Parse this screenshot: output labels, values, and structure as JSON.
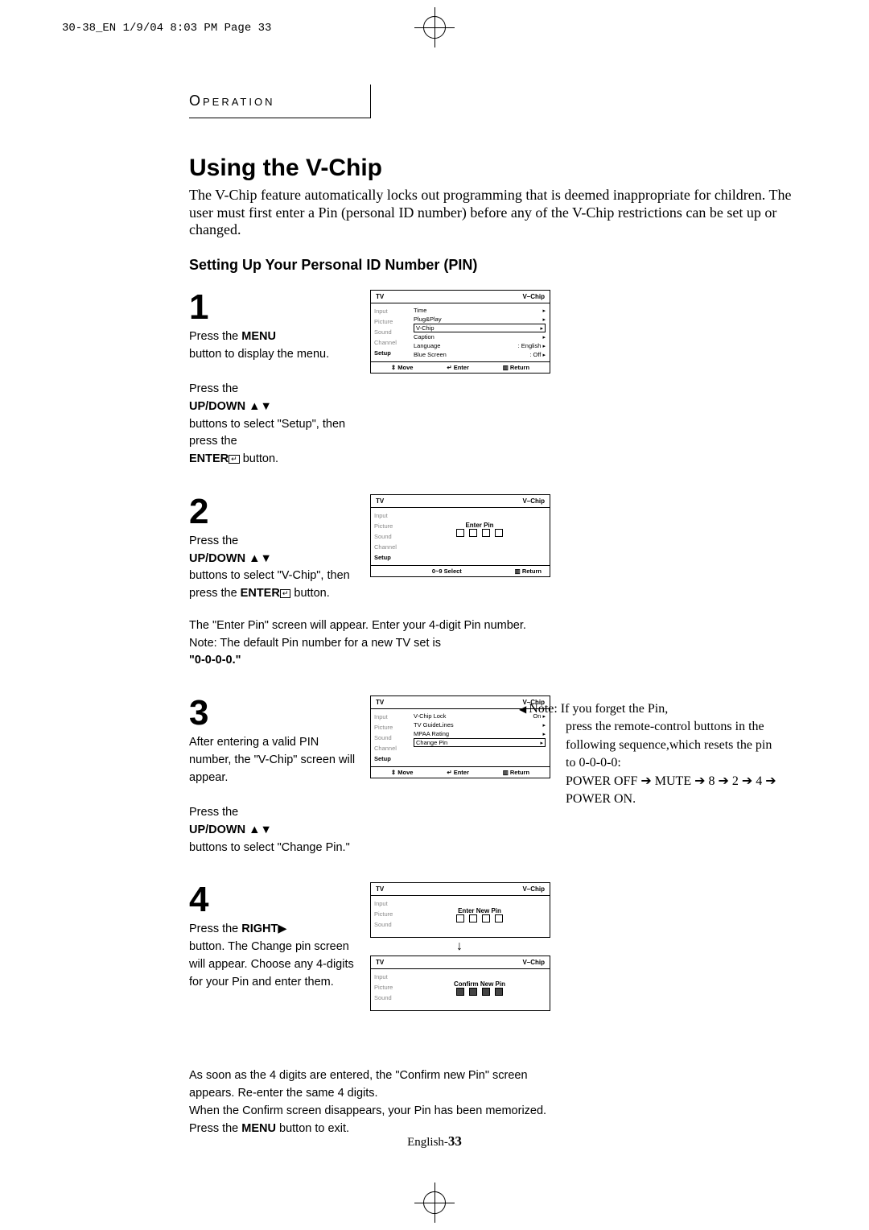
{
  "page_meta": "30-38_EN  1/9/04 8:03 PM  Page 33",
  "section_tab": "Operation",
  "title": "Using the V-Chip",
  "intro": "The V-Chip feature automatically locks out programming that is deemed inappropriate for children. The user must first enter a Pin (personal ID number) before any of the V-Chip restrictions can be set up or changed.",
  "subheading": "Setting Up Your Personal ID Number (PIN)",
  "steps": {
    "s1": {
      "num": "1",
      "t1": "Press the ",
      "t1b": "MENU",
      "t2": "button to display the menu.",
      "t3": "Press the",
      "t3b": "UP/DOWN",
      "t4": "buttons to select \"Setup\", then press the",
      "t4b": "ENTER",
      "t5": " button."
    },
    "s2": {
      "num": "2",
      "t1": "Press the",
      "t1b": "UP/DOWN",
      "t2": "buttons to select \"V-Chip\", then press the ",
      "t2b": "ENTER",
      "t3": " button.",
      "post": "The \"Enter Pin\" screen will appear. Enter your 4-digit Pin number. Note: The default Pin number for a new TV set is",
      "postb": "\"0-0-0-0.\""
    },
    "s3": {
      "num": "3",
      "t1": "After entering a valid PIN number, the \"V-Chip\" screen will appear.",
      "t2": "Press the",
      "t2b": "UP/DOWN",
      "t3": "buttons to select \"Change Pin.\""
    },
    "s4": {
      "num": "4",
      "t1": "Press the ",
      "t1b": "RIGHT",
      "t2": "button. The Change pin screen will appear. Choose any 4-digits for your Pin and enter them.",
      "post1": "As soon as the 4 digits are entered, the \"Confirm new Pin\" screen appears. Re-enter the same 4 digits.",
      "post2": "When the Confirm screen disappears, your Pin has been memorized.",
      "post3a": "Press the ",
      "post3b": "MENU",
      "post3c": " button to exit."
    }
  },
  "osd": {
    "tv": "TV",
    "vchip": "V–Chip",
    "left_items": [
      "Input",
      "Picture",
      "Sound",
      "Channel",
      "Setup"
    ],
    "menu1_rows": [
      {
        "label": "Time"
      },
      {
        "label": "Plug&Play"
      },
      {
        "label": "V-Chip",
        "sel": true
      },
      {
        "label": "Caption"
      },
      {
        "label": "Language",
        "val": ": English"
      },
      {
        "label": "Blue Screen",
        "val": ": Off"
      }
    ],
    "footer": {
      "move": "Move",
      "enter": "Enter",
      "return": "Return",
      "select": "0~9 Select"
    },
    "enter_pin": "Enter Pin",
    "menu3_rows": [
      {
        "label": "V-Chip Lock",
        "val": "On"
      },
      {
        "label": "TV GuideLines"
      },
      {
        "label": "MPAA Rating"
      },
      {
        "label": "Change Pin",
        "sel": true
      }
    ],
    "enter_new_pin": "Enter New Pin",
    "confirm_new_pin": "Confirm New Pin"
  },
  "note": {
    "lead": "Note:  If you forget the Pin,",
    "l1": "press the remote-control buttons in the following sequence,which resets the pin to 0-0-0-0:",
    "l2": "POWER OFF ➔ MUTE ➔ 8 ➔ 2 ➔ 4 ➔ POWER ON."
  },
  "page_footer": {
    "a": "English-",
    "b": "33"
  }
}
